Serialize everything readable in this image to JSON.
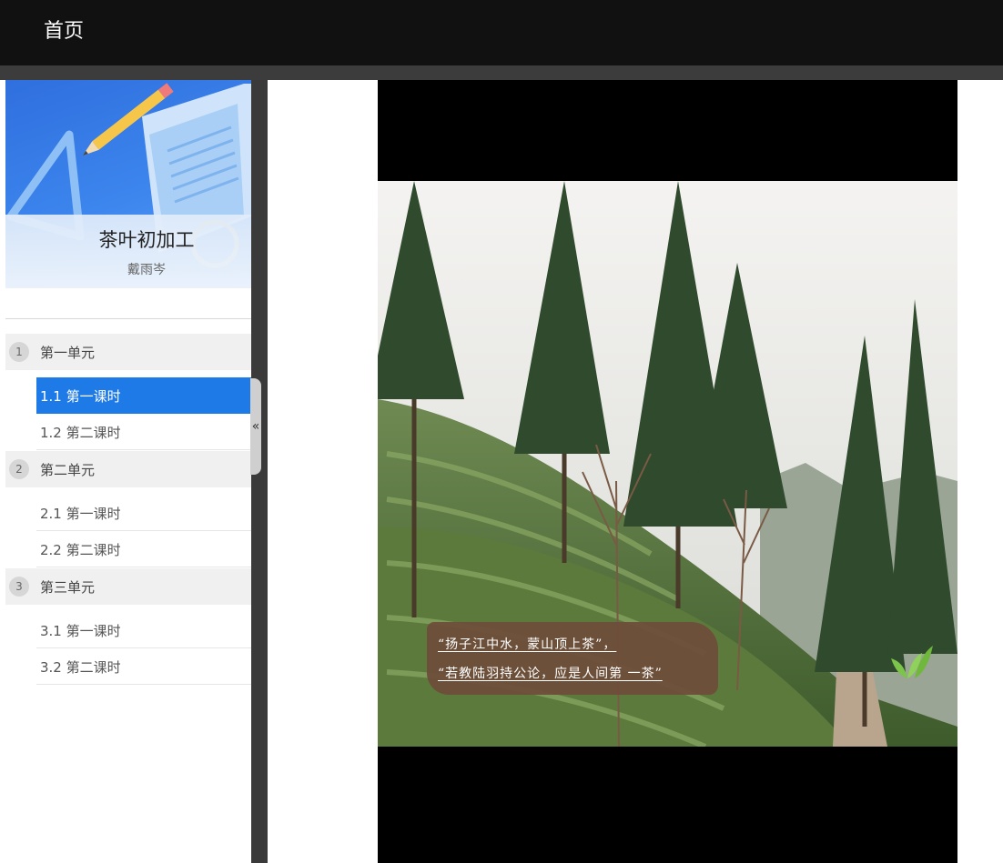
{
  "topbar": {
    "home_label": "首页"
  },
  "course": {
    "title": "茶叶初加工",
    "teacher": "戴雨岑"
  },
  "units": [
    {
      "number": "1",
      "label": "第一单元",
      "lessons": [
        {
          "label": "1.1  第一课时",
          "active": true
        },
        {
          "label": "1.2  第二课时",
          "active": false
        }
      ]
    },
    {
      "number": "2",
      "label": "第二单元",
      "lessons": [
        {
          "label": "2.1  第一课时",
          "active": false
        },
        {
          "label": "2.2  第二课时",
          "active": false
        }
      ]
    },
    {
      "number": "3",
      "label": "第三单元",
      "lessons": [
        {
          "label": "3.1  第一课时",
          "active": false
        },
        {
          "label": "3.2  第二课时",
          "active": false
        }
      ]
    }
  ],
  "sidebar": {
    "collapse_glyph": "«"
  },
  "video": {
    "caption_line1": "“扬子江中水，蒙山顶上茶”，",
    "caption_line2": "“若教陆羽持公论，应是人间第 一茶”"
  },
  "colors": {
    "active_item": "#1e7ae6",
    "caption_bg": "#6e4c3a",
    "topbar": "#111111"
  }
}
